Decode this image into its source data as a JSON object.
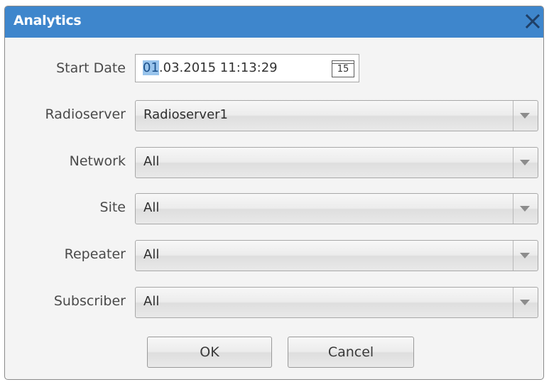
{
  "window": {
    "title": "Analytics",
    "close_icon": "close-icon"
  },
  "start_date": {
    "label": "Start Date",
    "value_selected": "01",
    "value_rest": ".03.2015 11:13:29",
    "calendar_icon": "calendar-icon",
    "calendar_day": "15"
  },
  "fields": [
    {
      "label": "Radioserver",
      "value": "Radioserver1"
    },
    {
      "label": "Network",
      "value": "All"
    },
    {
      "label": "Site",
      "value": "All"
    },
    {
      "label": "Repeater",
      "value": "All"
    },
    {
      "label": "Subscriber",
      "value": "All"
    }
  ],
  "buttons": {
    "ok_label": "OK",
    "cancel_label": "Cancel"
  },
  "colors": {
    "titlebar": "#3e86cc",
    "selection": "#99c4ec"
  }
}
